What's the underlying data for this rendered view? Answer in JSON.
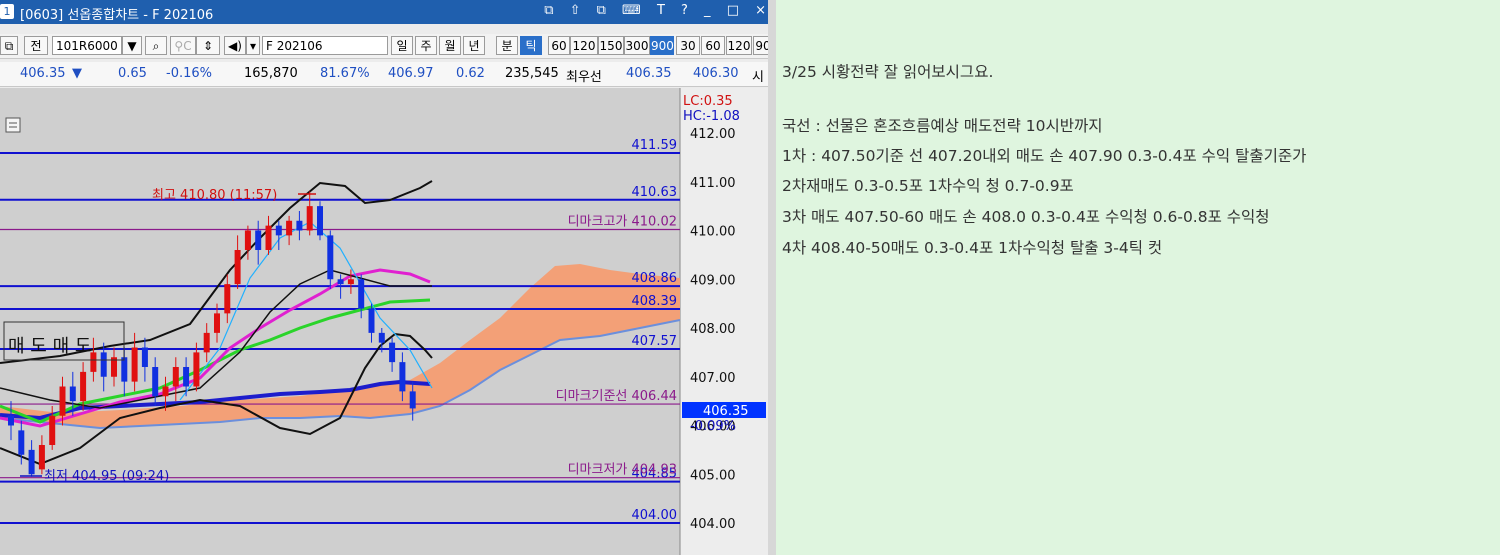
{
  "window": {
    "id": "1",
    "title": "[0603] 선옵종합차트 - F 202106",
    "title_icons": "⧉ ⇧ ⧉ ⌨ T ? _ □ ×"
  },
  "toolbar": {
    "prefix_btn": "",
    "prev_btn": "전",
    "code": "101R6000",
    "code_arrow": "▼",
    "search_icon": "🔍",
    "name_input": "F 202106",
    "periods": [
      "일",
      "주",
      "월",
      "년",
      "분",
      "틱"
    ],
    "selected_period": "틱",
    "intervals": [
      "60",
      "120",
      "150",
      "300",
      "900",
      "30",
      "60",
      "120",
      "90"
    ],
    "selected_interval": "900"
  },
  "quote": {
    "price": "406.35",
    "arrow": "▼",
    "change": "0.65",
    "pct": "-0.16%",
    "volume": "165,870",
    "ratio": "81.67%",
    "v1": "406.97",
    "v2": "0.62",
    "v3": "235,545",
    "label": "최우선",
    "ask": "406.35",
    "bid": "406.30",
    "tail": "시"
  },
  "chart_data": {
    "type": "candlestick",
    "y_ticks": [
      "412.00",
      "411.00",
      "410.00",
      "409.00",
      "408.00",
      "407.00",
      "406.00",
      "405.00",
      "404.00"
    ],
    "corner": {
      "lc": "LC:0.35",
      "hc": "HC:-1.08"
    },
    "levels": [
      {
        "value": 411.59,
        "label": "411.59",
        "color": "#1010d0"
      },
      {
        "value": 410.63,
        "label": "410.63",
        "color": "#1010d0"
      },
      {
        "value": 410.02,
        "label": "디마크고가 410.02",
        "color": "#8b1a8b"
      },
      {
        "value": 408.86,
        "label": "408.86",
        "color": "#1010d0"
      },
      {
        "value": 408.39,
        "label": "408.39",
        "color": "#1010d0"
      },
      {
        "value": 407.57,
        "label": "407.57",
        "color": "#1010d0"
      },
      {
        "value": 406.44,
        "label": "디마크기준선 406.44",
        "color": "#8b1a8b"
      },
      {
        "value": 404.85,
        "label": "404.85",
        "color": "#1010d0"
      },
      {
        "value": 404.93,
        "label": "디마크저가 404.93",
        "color": "#8b1a8b"
      },
      {
        "value": 404.0,
        "label": "404.00",
        "color": "#1010d0"
      }
    ],
    "current": {
      "label": "406.35",
      "change": "-0.09%"
    },
    "annotations": {
      "high": "최고 410.80 (11:57)",
      "low": "최저 404.95 (09:24)",
      "sell": "매 도 매 도"
    }
  },
  "notes": {
    "line1": "3/25  시황전략 잘 읽어보시그요.",
    "line2": "국선 : 선물은 혼조흐름예상   매도전략 10시반까지",
    "line3": "1차 :  407.50기준    선 407.20내외 매도     손 407.90     0.3-0.4포 수익   탈출기준가",
    "line4": "2차재매도      0.3-0.5포 1차수익 청    0.7-0.9포",
    "line5": "3차 매도    407.50-60 매도      손 408.0  0.3-0.4포 수익청    0.6-0.8포 수익청",
    "line6": "4차  408.40-50매도      0.3-0.4포 1차수익청      탈출  3-4틱 컷"
  }
}
